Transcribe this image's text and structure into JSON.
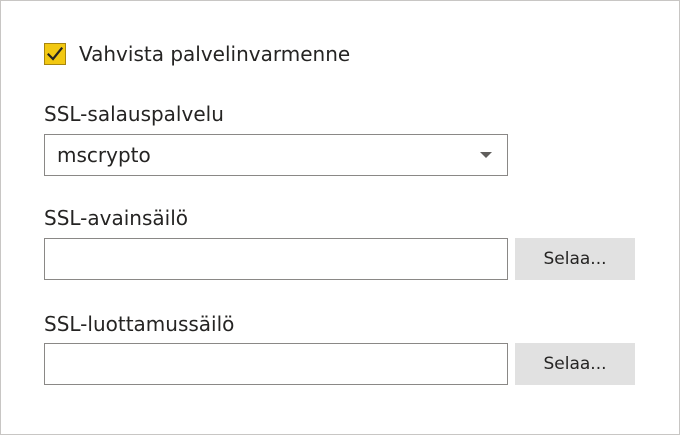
{
  "verify_cert": {
    "label": "Vahvista palvelinvarmenne",
    "checked": true,
    "accent_color": "#f2c811",
    "icon": "checkmark-icon"
  },
  "ssl_crypto_provider": {
    "label": "SSL-salauspalvelu",
    "selected": "mscrypto",
    "icon": "chevron-down-icon"
  },
  "ssl_key_store": {
    "label": "SSL-avainsäilö",
    "value": "",
    "browse_label": "Selaa..."
  },
  "ssl_trust_store": {
    "label": "SSL-luottamussäilö",
    "value": "",
    "browse_label": "Selaa..."
  }
}
